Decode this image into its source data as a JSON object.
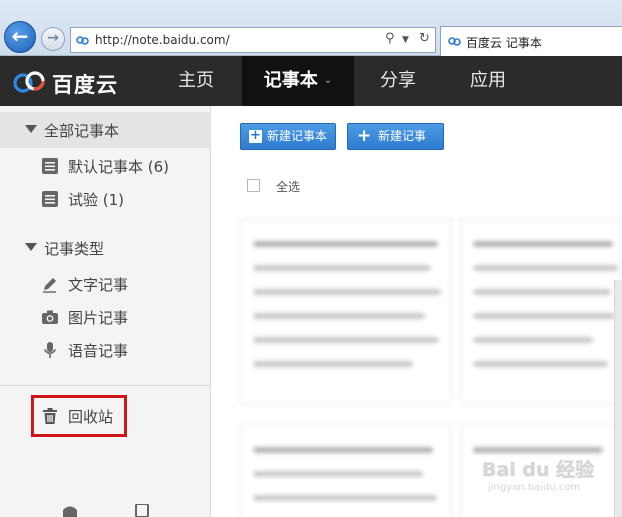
{
  "browser": {
    "url": "http://note.baidu.com/",
    "tab_title": "百度云 记事本"
  },
  "app": {
    "logo_text": "百度云",
    "nav": [
      {
        "label": "主页"
      },
      {
        "label": "记事本",
        "active": true
      },
      {
        "label": "分享"
      },
      {
        "label": "应用"
      }
    ]
  },
  "sidebar": {
    "all_notebooks": "全部记事本",
    "notebooks": [
      {
        "label": "默认记事本 (6)"
      },
      {
        "label": "试验 (1)"
      }
    ],
    "note_types_header": "记事类型",
    "note_types": [
      {
        "label": "文字记事",
        "icon": "pencil-icon"
      },
      {
        "label": "图片记事",
        "icon": "camera-icon"
      },
      {
        "label": "语音记事",
        "icon": "microphone-icon"
      }
    ],
    "trash": {
      "label": "回收站",
      "icon": "trash-icon",
      "highlight_color": "#d0161a"
    }
  },
  "main": {
    "new_notebook_button": "新建记事本",
    "new_note_button": "新建记事",
    "select_all": "全选"
  },
  "watermark": {
    "text": "Bai du 经验",
    "sub": "jingyan.baidu.com"
  },
  "colors": {
    "accent": "#2d7bd0",
    "header_bg": "#2b2b2b",
    "highlight": "#d0161a"
  }
}
